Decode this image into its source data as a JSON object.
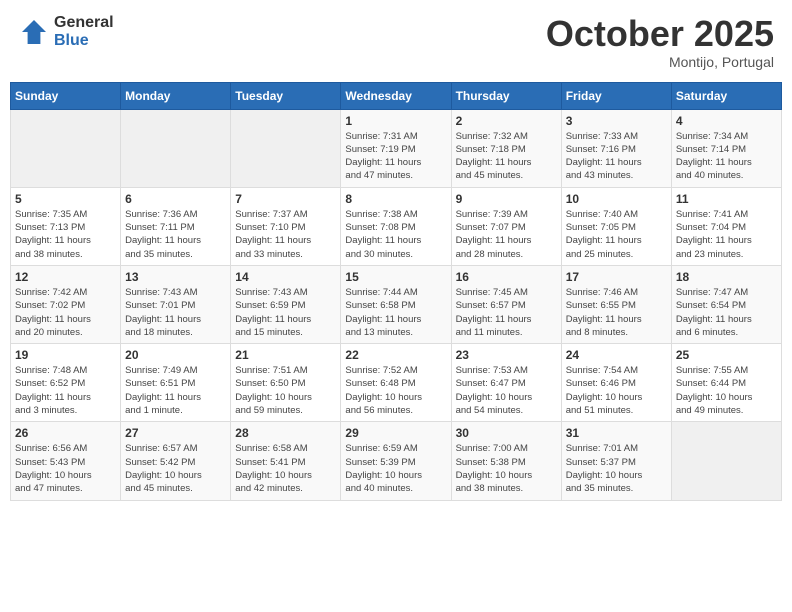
{
  "logo": {
    "general": "General",
    "blue": "Blue"
  },
  "header": {
    "month": "October 2025",
    "location": "Montijo, Portugal"
  },
  "weekdays": [
    "Sunday",
    "Monday",
    "Tuesday",
    "Wednesday",
    "Thursday",
    "Friday",
    "Saturday"
  ],
  "weeks": [
    [
      {
        "day": "",
        "info": ""
      },
      {
        "day": "",
        "info": ""
      },
      {
        "day": "",
        "info": ""
      },
      {
        "day": "1",
        "info": "Sunrise: 7:31 AM\nSunset: 7:19 PM\nDaylight: 11 hours\nand 47 minutes."
      },
      {
        "day": "2",
        "info": "Sunrise: 7:32 AM\nSunset: 7:18 PM\nDaylight: 11 hours\nand 45 minutes."
      },
      {
        "day": "3",
        "info": "Sunrise: 7:33 AM\nSunset: 7:16 PM\nDaylight: 11 hours\nand 43 minutes."
      },
      {
        "day": "4",
        "info": "Sunrise: 7:34 AM\nSunset: 7:14 PM\nDaylight: 11 hours\nand 40 minutes."
      }
    ],
    [
      {
        "day": "5",
        "info": "Sunrise: 7:35 AM\nSunset: 7:13 PM\nDaylight: 11 hours\nand 38 minutes."
      },
      {
        "day": "6",
        "info": "Sunrise: 7:36 AM\nSunset: 7:11 PM\nDaylight: 11 hours\nand 35 minutes."
      },
      {
        "day": "7",
        "info": "Sunrise: 7:37 AM\nSunset: 7:10 PM\nDaylight: 11 hours\nand 33 minutes."
      },
      {
        "day": "8",
        "info": "Sunrise: 7:38 AM\nSunset: 7:08 PM\nDaylight: 11 hours\nand 30 minutes."
      },
      {
        "day": "9",
        "info": "Sunrise: 7:39 AM\nSunset: 7:07 PM\nDaylight: 11 hours\nand 28 minutes."
      },
      {
        "day": "10",
        "info": "Sunrise: 7:40 AM\nSunset: 7:05 PM\nDaylight: 11 hours\nand 25 minutes."
      },
      {
        "day": "11",
        "info": "Sunrise: 7:41 AM\nSunset: 7:04 PM\nDaylight: 11 hours\nand 23 minutes."
      }
    ],
    [
      {
        "day": "12",
        "info": "Sunrise: 7:42 AM\nSunset: 7:02 PM\nDaylight: 11 hours\nand 20 minutes."
      },
      {
        "day": "13",
        "info": "Sunrise: 7:43 AM\nSunset: 7:01 PM\nDaylight: 11 hours\nand 18 minutes."
      },
      {
        "day": "14",
        "info": "Sunrise: 7:43 AM\nSunset: 6:59 PM\nDaylight: 11 hours\nand 15 minutes."
      },
      {
        "day": "15",
        "info": "Sunrise: 7:44 AM\nSunset: 6:58 PM\nDaylight: 11 hours\nand 13 minutes."
      },
      {
        "day": "16",
        "info": "Sunrise: 7:45 AM\nSunset: 6:57 PM\nDaylight: 11 hours\nand 11 minutes."
      },
      {
        "day": "17",
        "info": "Sunrise: 7:46 AM\nSunset: 6:55 PM\nDaylight: 11 hours\nand 8 minutes."
      },
      {
        "day": "18",
        "info": "Sunrise: 7:47 AM\nSunset: 6:54 PM\nDaylight: 11 hours\nand 6 minutes."
      }
    ],
    [
      {
        "day": "19",
        "info": "Sunrise: 7:48 AM\nSunset: 6:52 PM\nDaylight: 11 hours\nand 3 minutes."
      },
      {
        "day": "20",
        "info": "Sunrise: 7:49 AM\nSunset: 6:51 PM\nDaylight: 11 hours\nand 1 minute."
      },
      {
        "day": "21",
        "info": "Sunrise: 7:51 AM\nSunset: 6:50 PM\nDaylight: 10 hours\nand 59 minutes."
      },
      {
        "day": "22",
        "info": "Sunrise: 7:52 AM\nSunset: 6:48 PM\nDaylight: 10 hours\nand 56 minutes."
      },
      {
        "day": "23",
        "info": "Sunrise: 7:53 AM\nSunset: 6:47 PM\nDaylight: 10 hours\nand 54 minutes."
      },
      {
        "day": "24",
        "info": "Sunrise: 7:54 AM\nSunset: 6:46 PM\nDaylight: 10 hours\nand 51 minutes."
      },
      {
        "day": "25",
        "info": "Sunrise: 7:55 AM\nSunset: 6:44 PM\nDaylight: 10 hours\nand 49 minutes."
      }
    ],
    [
      {
        "day": "26",
        "info": "Sunrise: 6:56 AM\nSunset: 5:43 PM\nDaylight: 10 hours\nand 47 minutes."
      },
      {
        "day": "27",
        "info": "Sunrise: 6:57 AM\nSunset: 5:42 PM\nDaylight: 10 hours\nand 45 minutes."
      },
      {
        "day": "28",
        "info": "Sunrise: 6:58 AM\nSunset: 5:41 PM\nDaylight: 10 hours\nand 42 minutes."
      },
      {
        "day": "29",
        "info": "Sunrise: 6:59 AM\nSunset: 5:39 PM\nDaylight: 10 hours\nand 40 minutes."
      },
      {
        "day": "30",
        "info": "Sunrise: 7:00 AM\nSunset: 5:38 PM\nDaylight: 10 hours\nand 38 minutes."
      },
      {
        "day": "31",
        "info": "Sunrise: 7:01 AM\nSunset: 5:37 PM\nDaylight: 10 hours\nand 35 minutes."
      },
      {
        "day": "",
        "info": ""
      }
    ]
  ]
}
